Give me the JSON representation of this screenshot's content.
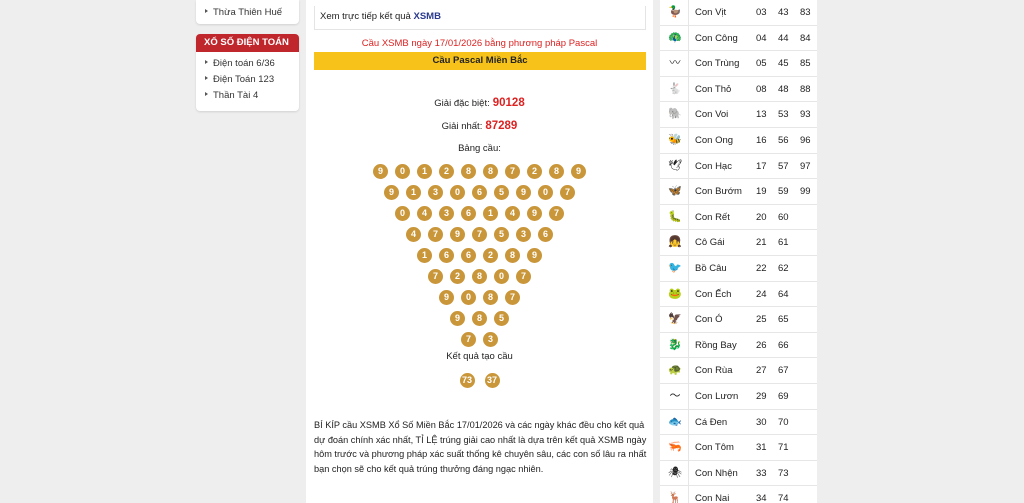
{
  "sidebar": {
    "top_items": [
      {
        "label": "Thừa Thiên Huế"
      }
    ],
    "dien_toan": {
      "title": "XỔ SỐ ĐIỆN TOÁN",
      "items": [
        {
          "label": "Điện toán 6/36"
        },
        {
          "label": "Điện Toán 123"
        },
        {
          "label": "Thần Tài 4"
        }
      ]
    }
  },
  "main": {
    "live_prefix": "Xem trực tiếp kết quả",
    "live_link": "XSMB",
    "note": "Cầu XSMB ngày 17/01/2026 bằng phương pháp Pascal",
    "banner": "Cầu Pascal Miền Bắc",
    "special_label": "Giải đặc biệt:",
    "special_value": "90128",
    "first_label": "Giải nhất:",
    "first_value": "87289",
    "table_label": "Bảng cầu:",
    "pyramid": [
      [
        "9",
        "0",
        "1",
        "2",
        "8",
        "8",
        "7",
        "2",
        "8",
        "9"
      ],
      [
        "9",
        "1",
        "3",
        "0",
        "6",
        "5",
        "9",
        "0",
        "7"
      ],
      [
        "0",
        "4",
        "3",
        "6",
        "1",
        "4",
        "9",
        "7"
      ],
      [
        "4",
        "7",
        "9",
        "7",
        "5",
        "3",
        "6"
      ],
      [
        "1",
        "6",
        "6",
        "2",
        "8",
        "9"
      ],
      [
        "7",
        "2",
        "8",
        "0",
        "7"
      ],
      [
        "9",
        "0",
        "8",
        "7"
      ],
      [
        "9",
        "8",
        "5"
      ],
      [
        "7",
        "3"
      ]
    ],
    "result_label": "Kết quả tạo cầu",
    "result": [
      "73",
      "37"
    ],
    "paragraph": "BÍ KÍP cầu XSMB Xổ Số Miền Bắc 17/01/2026 và các ngày khác đều cho kết quả dự đoán chính xác nhất, TỈ LỆ trúng giải cao nhất là dựa trên kết quả XSMB ngày hôm trước và phương pháp xác suất thống kê chuyên sâu, các con số lâu ra nhất bạn chọn sẽ cho kết quả trúng thưởng đáng ngạc nhiên."
  },
  "dream_table": [
    {
      "icon": "duck-icon",
      "glyph": "🦆",
      "name": "Con Vịt",
      "n1": "03",
      "n2": "43",
      "n3": "83"
    },
    {
      "icon": "peacock-icon",
      "glyph": "🦚",
      "name": "Con Công",
      "n1": "04",
      "n2": "44",
      "n3": "84"
    },
    {
      "icon": "worm-icon",
      "glyph": "〰",
      "name": "Con Trùng",
      "n1": "05",
      "n2": "45",
      "n3": "85"
    },
    {
      "icon": "rabbit-icon",
      "glyph": "🐇",
      "name": "Con Thỏ",
      "n1": "08",
      "n2": "48",
      "n3": "88"
    },
    {
      "icon": "elephant-icon",
      "glyph": "🐘",
      "name": "Con Voi",
      "n1": "13",
      "n2": "53",
      "n3": "93"
    },
    {
      "icon": "bee-icon",
      "glyph": "🐝",
      "name": "Con Ong",
      "n1": "16",
      "n2": "56",
      "n3": "96"
    },
    {
      "icon": "crane-icon",
      "glyph": "🕊",
      "name": "Con Hạc",
      "n1": "17",
      "n2": "57",
      "n3": "97"
    },
    {
      "icon": "butterfly-icon",
      "glyph": "🦋",
      "name": "Con Bướm",
      "n1": "19",
      "n2": "59",
      "n3": "99"
    },
    {
      "icon": "centipede-icon",
      "glyph": "🐛",
      "name": "Con Rết",
      "n1": "20",
      "n2": "60",
      "n3": ""
    },
    {
      "icon": "girl-icon",
      "glyph": "👧",
      "name": "Cô Gái",
      "n1": "21",
      "n2": "61",
      "n3": ""
    },
    {
      "icon": "pigeon-icon",
      "glyph": "🐦",
      "name": "Bồ Câu",
      "n1": "22",
      "n2": "62",
      "n3": ""
    },
    {
      "icon": "frog-icon",
      "glyph": "🐸",
      "name": "Con Ếch",
      "n1": "24",
      "n2": "64",
      "n3": ""
    },
    {
      "icon": "eagle-icon",
      "glyph": "🦅",
      "name": "Con Ó",
      "n1": "25",
      "n2": "65",
      "n3": ""
    },
    {
      "icon": "dragon-icon",
      "glyph": "🐉",
      "name": "Rồng Bay",
      "n1": "26",
      "n2": "66",
      "n3": ""
    },
    {
      "icon": "turtle-icon",
      "glyph": "🐢",
      "name": "Con Rùa",
      "n1": "27",
      "n2": "67",
      "n3": ""
    },
    {
      "icon": "eel-icon",
      "glyph": "〜",
      "name": "Con Lươn",
      "n1": "29",
      "n2": "69",
      "n3": ""
    },
    {
      "icon": "fish-icon",
      "glyph": "🐟",
      "name": "Cá Đen",
      "n1": "30",
      "n2": "70",
      "n3": ""
    },
    {
      "icon": "shrimp-icon",
      "glyph": "🦐",
      "name": "Con Tôm",
      "n1": "31",
      "n2": "71",
      "n3": ""
    },
    {
      "icon": "spider-icon",
      "glyph": "🕷",
      "name": "Con Nhện",
      "n1": "33",
      "n2": "73",
      "n3": ""
    },
    {
      "icon": "deer-icon",
      "glyph": "🦌",
      "name": "Con Nai",
      "n1": "34",
      "n2": "74",
      "n3": ""
    }
  ],
  "colors": {
    "accent_red": "#c0272d",
    "banner_yellow": "#f7c31a",
    "ball_gold": "#c9963a",
    "link_blue": "#2a3a8c"
  }
}
